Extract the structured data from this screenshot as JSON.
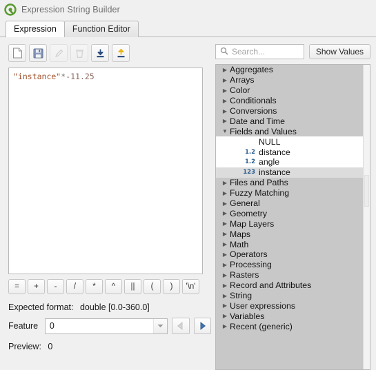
{
  "window": {
    "title": "Expression String Builder",
    "logo_icon": "qgis-logo-icon"
  },
  "tabs": [
    {
      "label": "Expression",
      "active": true
    },
    {
      "label": "Function Editor",
      "active": false
    }
  ],
  "toolbar": {
    "buttons": [
      {
        "name": "new-expression-button",
        "icon": "new-file-icon",
        "glyph": "⬜",
        "enabled": true
      },
      {
        "name": "save-expression-button",
        "icon": "save-floppy-icon",
        "glyph": "💾",
        "enabled": true
      },
      {
        "name": "edit-expression-button",
        "icon": "pencil-edit-icon",
        "glyph": "✎",
        "enabled": false
      },
      {
        "name": "delete-expression-button",
        "icon": "trash-delete-icon",
        "glyph": "🗑",
        "enabled": false
      },
      {
        "name": "import-expressions-button",
        "icon": "import-download-icon",
        "glyph": "⬇",
        "enabled": true
      },
      {
        "name": "export-expressions-button",
        "icon": "export-upload-icon",
        "glyph": "⬆",
        "enabled": true
      }
    ]
  },
  "editor": {
    "expression_tokens": [
      {
        "text": "\"instance\"",
        "type": "field"
      },
      {
        "text": "*",
        "type": "op"
      },
      {
        "text": "-11.25",
        "type": "num"
      }
    ],
    "expression_plain": "\"instance\"*-11.25"
  },
  "operators": [
    {
      "label": "=",
      "name": "operator-equals"
    },
    {
      "label": "+",
      "name": "operator-plus"
    },
    {
      "label": "-",
      "name": "operator-minus"
    },
    {
      "label": "/",
      "name": "operator-divide"
    },
    {
      "label": "*",
      "name": "operator-multiply"
    },
    {
      "label": "^",
      "name": "operator-power"
    },
    {
      "label": "||",
      "name": "operator-concat"
    },
    {
      "label": "(",
      "name": "operator-open-paren"
    },
    {
      "label": ")",
      "name": "operator-close-paren"
    },
    {
      "label": "'\\n'",
      "name": "operator-newline"
    }
  ],
  "form": {
    "expected_format_label": "Expected format:",
    "expected_format_value": "double [0.0-360.0]",
    "feature_label": "Feature",
    "feature_value": "0",
    "prev_feature_icon": "triangle-left-icon",
    "next_feature_icon": "triangle-right-icon",
    "preview_label": "Preview:",
    "preview_value": "0"
  },
  "search": {
    "icon": "search-magnifier-icon",
    "placeholder": "Search...",
    "value": "",
    "show_values_label": "Show Values"
  },
  "tree": {
    "items": [
      {
        "label": "Aggregates",
        "expanded": false,
        "selected": false
      },
      {
        "label": "Arrays",
        "expanded": false,
        "selected": false
      },
      {
        "label": "Color",
        "expanded": false,
        "selected": false
      },
      {
        "label": "Conditionals",
        "expanded": false,
        "selected": false
      },
      {
        "label": "Conversions",
        "expanded": false,
        "selected": false
      },
      {
        "label": "Date and Time",
        "expanded": false,
        "selected": false
      },
      {
        "label": "Fields and Values",
        "expanded": true,
        "selected": false,
        "children": [
          {
            "label": "NULL",
            "type_badge": "",
            "selected": false
          },
          {
            "label": "distance",
            "type_badge": "1.2",
            "selected": false
          },
          {
            "label": "angle",
            "type_badge": "1.2",
            "selected": false
          },
          {
            "label": "instance",
            "type_badge": "123",
            "selected": true
          }
        ]
      },
      {
        "label": "Files and Paths",
        "expanded": false,
        "selected": false
      },
      {
        "label": "Fuzzy Matching",
        "expanded": false,
        "selected": false
      },
      {
        "label": "General",
        "expanded": false,
        "selected": false
      },
      {
        "label": "Geometry",
        "expanded": false,
        "selected": false
      },
      {
        "label": "Map Layers",
        "expanded": false,
        "selected": false
      },
      {
        "label": "Maps",
        "expanded": false,
        "selected": false
      },
      {
        "label": "Math",
        "expanded": false,
        "selected": false
      },
      {
        "label": "Operators",
        "expanded": false,
        "selected": false
      },
      {
        "label": "Processing",
        "expanded": false,
        "selected": false
      },
      {
        "label": "Rasters",
        "expanded": false,
        "selected": false
      },
      {
        "label": "Record and Attributes",
        "expanded": false,
        "selected": false
      },
      {
        "label": "String",
        "expanded": false,
        "selected": false
      },
      {
        "label": "User expressions",
        "expanded": false,
        "selected": false
      },
      {
        "label": "Variables",
        "expanded": false,
        "selected": false
      },
      {
        "label": "Recent (generic)",
        "expanded": false,
        "selected": false
      }
    ],
    "collapsed_caret": "▶",
    "expanded_caret": "▼"
  },
  "colors": {
    "dialog_bg": "#f0f0f0",
    "tree_bg": "#c8c8c8",
    "field_token": "#a0522d",
    "selection": "#d4d4d4",
    "accent_blue": "#3f72b8",
    "qgis_green": "#589632"
  }
}
